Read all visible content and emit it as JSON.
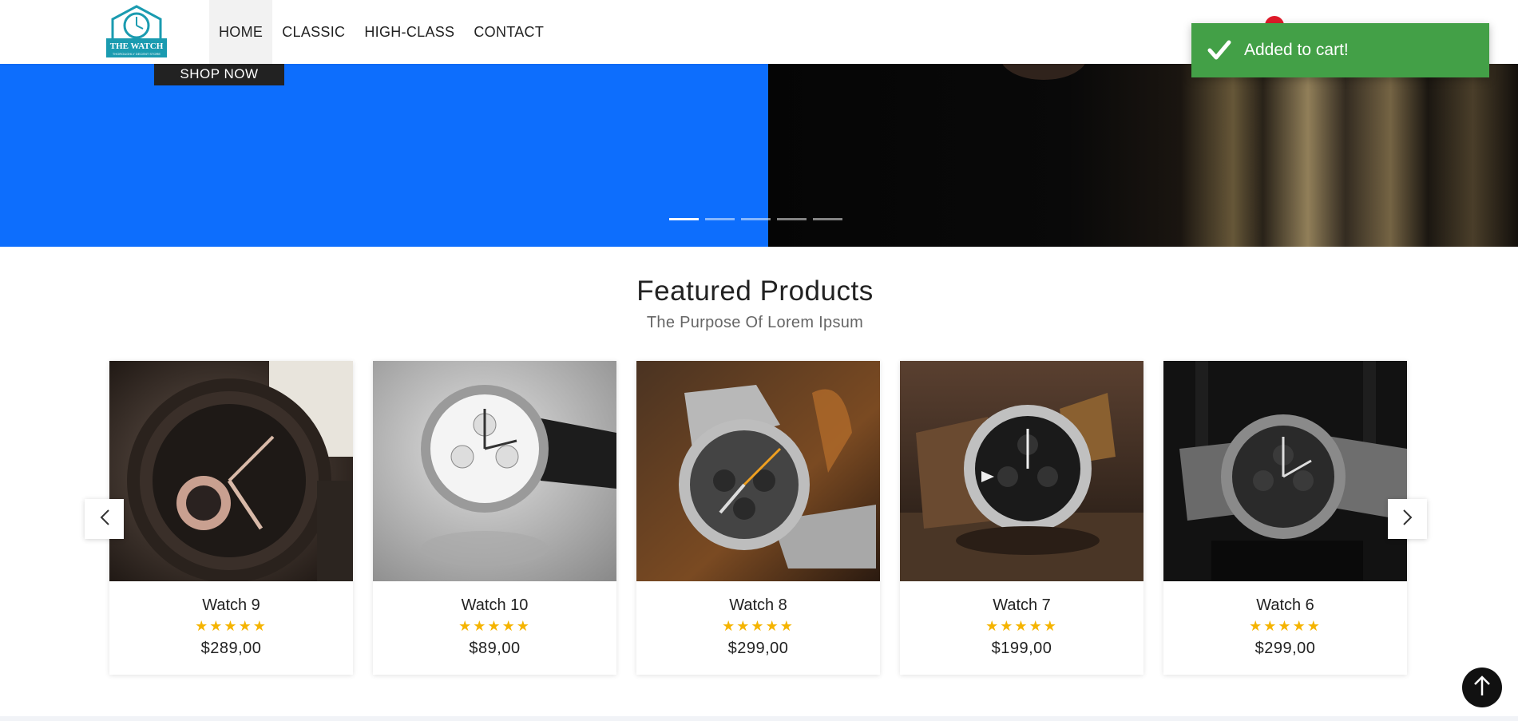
{
  "logo": {
    "line1": "THE WATCH",
    "line2": "THOROUGHLY DECENT STORE"
  },
  "nav": [
    {
      "label": "HOME"
    },
    {
      "label": "CLASSIC"
    },
    {
      "label": "HIGH-CLASS"
    },
    {
      "label": "CONTACT"
    }
  ],
  "toast": {
    "text": "Added to cart!",
    "color": "#43a047"
  },
  "hero": {
    "button_label": "SHOP NOW",
    "accent": "#0d6efd",
    "slide_count": 5,
    "active_slide": 1
  },
  "featured": {
    "title": "Featured Products",
    "subtitle": "The Purpose Of Lorem Ipsum"
  },
  "products": [
    {
      "name": "Watch 9",
      "stars": "★★★★★",
      "price": "$289,00"
    },
    {
      "name": "Watch 10",
      "stars": "★★★★★",
      "price": "$89,00"
    },
    {
      "name": "Watch 8",
      "stars": "★★★★★",
      "price": "$299,00"
    },
    {
      "name": "Watch 7",
      "stars": "★★★★★",
      "price": "$199,00"
    },
    {
      "name": "Watch 6",
      "stars": "★★★★★",
      "price": "$299,00"
    }
  ],
  "icons": {
    "prev": "chevron-left-icon",
    "next": "chevron-right-icon",
    "top": "arrow-up-icon",
    "toast": "check-icon"
  }
}
